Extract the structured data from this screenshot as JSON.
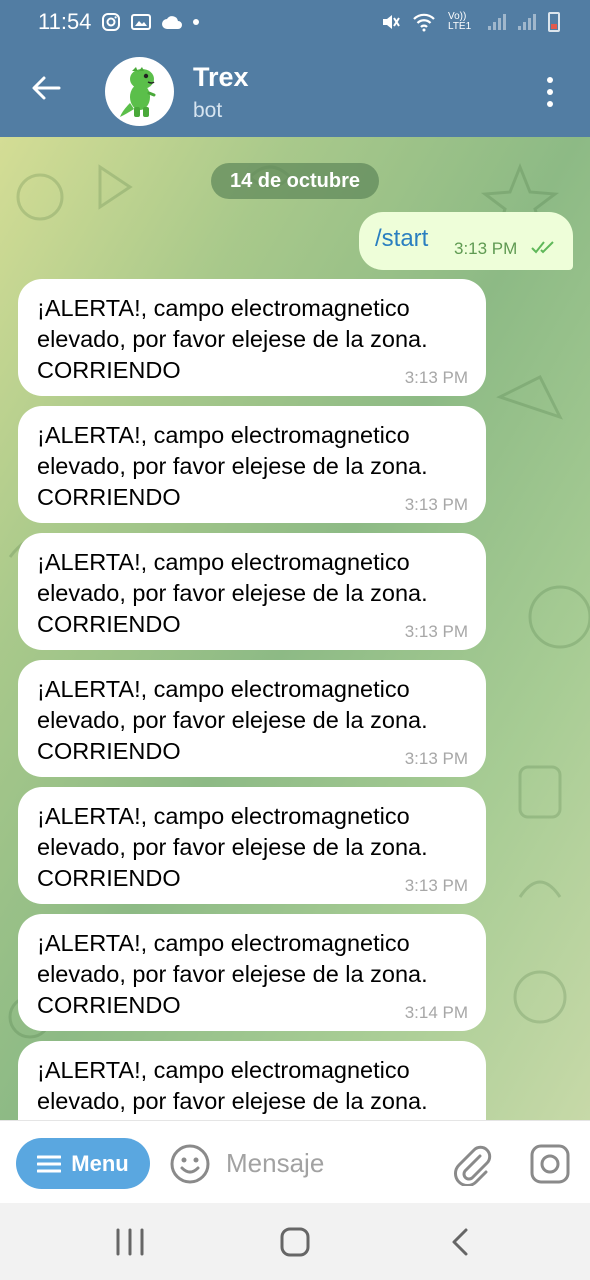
{
  "status_bar": {
    "time": "11:54",
    "network_label": "Vo)) LTE1"
  },
  "header": {
    "title": "Trex",
    "subtitle": "bot",
    "avatar_icon": "dinosaur-icon",
    "back_icon": "arrow-left-icon",
    "more_icon": "more-vertical-icon"
  },
  "chat": {
    "date_label": "14 de octubre",
    "outgoing": {
      "text": "/start",
      "time": "3:13 PM",
      "status": "read"
    },
    "messages": [
      {
        "text": "¡ALERTA!, campo electromagnetico\nelevado, por favor elejese de la zona.\nCORRIENDO",
        "time": "3:13 PM"
      },
      {
        "text": "¡ALERTA!, campo electromagnetico\nelevado, por favor elejese de la zona.\nCORRIENDO",
        "time": "3:13 PM"
      },
      {
        "text": "¡ALERTA!, campo electromagnetico\nelevado, por favor elejese de la zona.\nCORRIENDO",
        "time": "3:13 PM"
      },
      {
        "text": "¡ALERTA!, campo electromagnetico\nelevado, por favor elejese de la zona.\nCORRIENDO",
        "time": "3:13 PM"
      },
      {
        "text": "¡ALERTA!, campo electromagnetico\nelevado, por favor elejese de la zona.\nCORRIENDO",
        "time": "3:13 PM"
      },
      {
        "text": "¡ALERTA!, campo electromagnetico\nelevado, por favor elejese de la zona.\nCORRIENDO",
        "time": "3:14 PM"
      },
      {
        "text": "¡ALERTA!, campo electromagnetico\nelevado, por favor elejese de la zona.",
        "time": ""
      }
    ]
  },
  "composer": {
    "menu_label": "Menu",
    "input_value": "",
    "input_placeholder": "Mensaje"
  },
  "colors": {
    "header": "#527da3",
    "outgoing_bubble": "#eefed9",
    "link_text": "#2a7fc0",
    "menu_button": "#5aa7e0"
  }
}
